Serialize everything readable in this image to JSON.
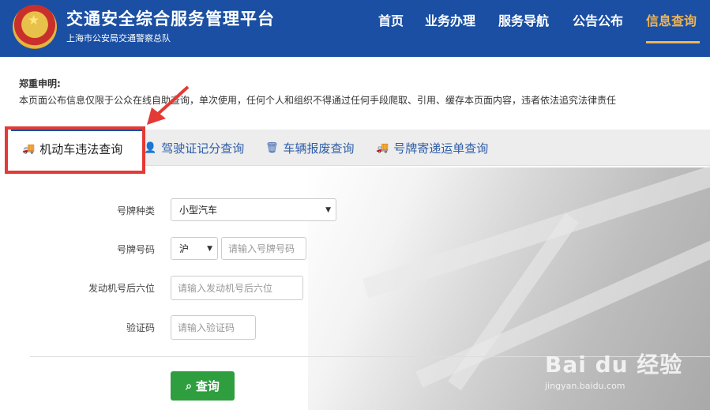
{
  "header": {
    "title": "交通安全综合服务管理平台",
    "subtitle": "上海市公安局交通警察总队",
    "nav": [
      "首页",
      "业务办理",
      "服务导航",
      "公告公布",
      "信息查询"
    ],
    "active_nav": "信息查询"
  },
  "notice": {
    "title": "郑重申明:",
    "text": "本页面公布信息仅限于公众在线自助查询，单次使用，任何个人和组织不得通过任何手段爬取、引用、缓存本页面内容，违者依法追究法律责任"
  },
  "tabs": [
    {
      "label": "机动车违法查询",
      "icon": "truck-icon",
      "active": true
    },
    {
      "label": "驾驶证记分查询",
      "icon": "person-icon",
      "active": false
    },
    {
      "label": "车辆报废查询",
      "icon": "trash-icon",
      "active": false
    },
    {
      "label": "号牌寄递运单查询",
      "icon": "truck-icon",
      "active": false
    }
  ],
  "form": {
    "plate_type_label": "号牌种类",
    "plate_type_value": "小型汽车",
    "plate_number_label": "号牌号码",
    "plate_prefix_value": "沪",
    "plate_number_placeholder": "请输入号牌号码",
    "engine_label": "发动机号后六位",
    "engine_placeholder": "请输入发动机号后六位",
    "captcha_label": "验证码",
    "captcha_placeholder": "请输入验证码",
    "submit_label": "查询"
  },
  "watermark": {
    "main": "Bai du 经验",
    "sub": "jingyan.baidu.com"
  },
  "colors": {
    "header_bg": "#1a4fa3",
    "active_nav": "#f0b453",
    "highlight": "#e43a35",
    "button": "#2e9e3f"
  }
}
